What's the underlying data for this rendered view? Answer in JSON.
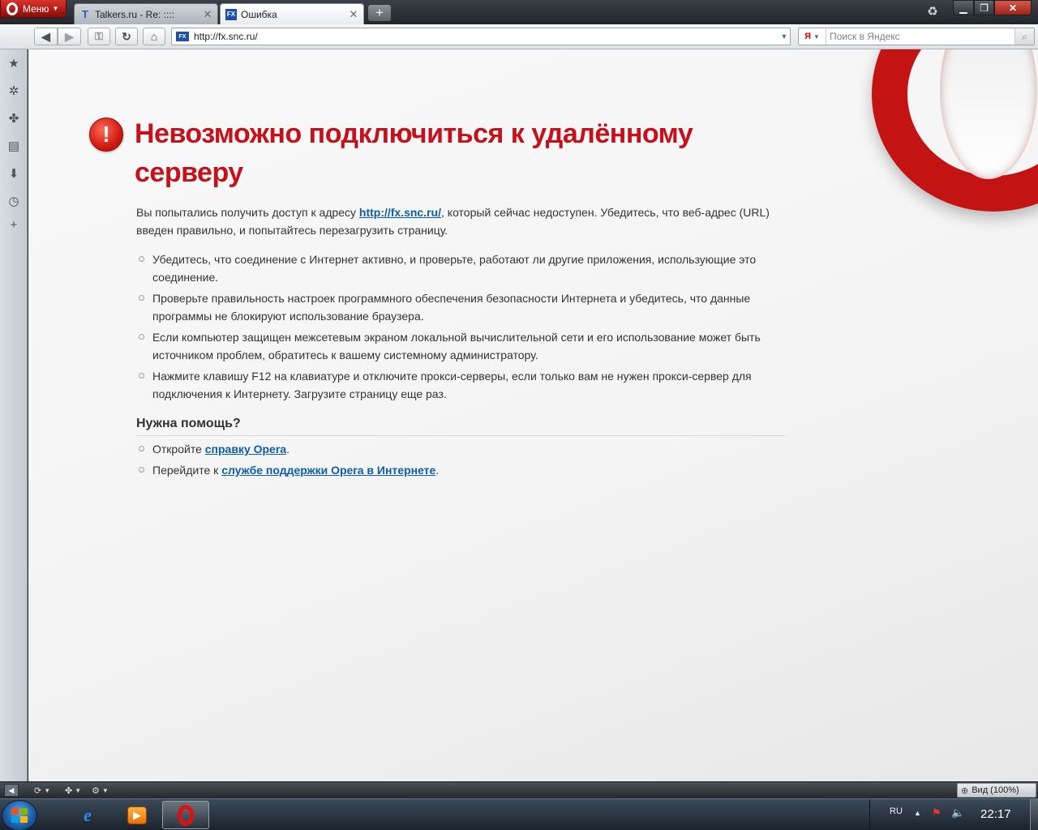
{
  "browser": {
    "menu_label": "Меню",
    "tabs": [
      {
        "title": "Talkers.ru - Re: ::::",
        "favicon": "T",
        "active": false
      },
      {
        "title": "Ошибка",
        "favicon": "FX",
        "active": true
      }
    ],
    "new_tab_label": "+",
    "address": {
      "url": "http://fx.snc.ru/",
      "favicon": "FX"
    },
    "search": {
      "engine_glyph": "Я",
      "placeholder": "Поиск в Яндекс"
    }
  },
  "page": {
    "title": "Невозможно подключиться к удалённому серверу",
    "intro": {
      "before": "Вы попытались получить доступ к адресу ",
      "link": "http://fx.snc.ru/",
      "after": ", который сейчас недоступен. Убедитесь, что веб-адрес (URL) введен правильно, и попытайтесь перезагрузить страницу."
    },
    "tips": [
      "Убедитесь, что соединение с Интернет активно, и проверьте, работают ли другие приложения, использующие это соединение.",
      "Проверьте правильность настроек программного обеспечения безопасности Интернета и убедитесь, что данные программы не блокируют использование браузера.",
      "Если компьютер защищен межсетевым экраном локальной вычислительной сети и его использование может быть источником проблем, обратитесь к вашему системному администратору.",
      "Нажмите клавишу F12 на клавиатуре и отключите прокси-серверы, если только вам не нужен прокси-сервер для подключения к Интернету. Загрузите страницу еще раз."
    ],
    "help": {
      "heading": "Нужна помощь?",
      "items": [
        {
          "before": "Откройте ",
          "link": "справку Opera",
          "after": "."
        },
        {
          "before": "Перейдите к ",
          "link": "службе поддержки Opera в Интернете",
          "after": "."
        }
      ]
    }
  },
  "statusbar": {
    "zoom_label": "Вид (100%)"
  },
  "taskbar": {
    "language": "RU",
    "clock": "22:17"
  },
  "icons": {
    "panel": [
      "bookmarks-icon",
      "widgets-icon",
      "unite-icon",
      "notes-icon",
      "downloads-icon",
      "history-icon",
      "add-panel-icon"
    ],
    "error": "error-exclamation-icon"
  },
  "colors": {
    "error_title": "#c6101a",
    "link": "#0b5fa8",
    "opera_red": "#c41313"
  }
}
